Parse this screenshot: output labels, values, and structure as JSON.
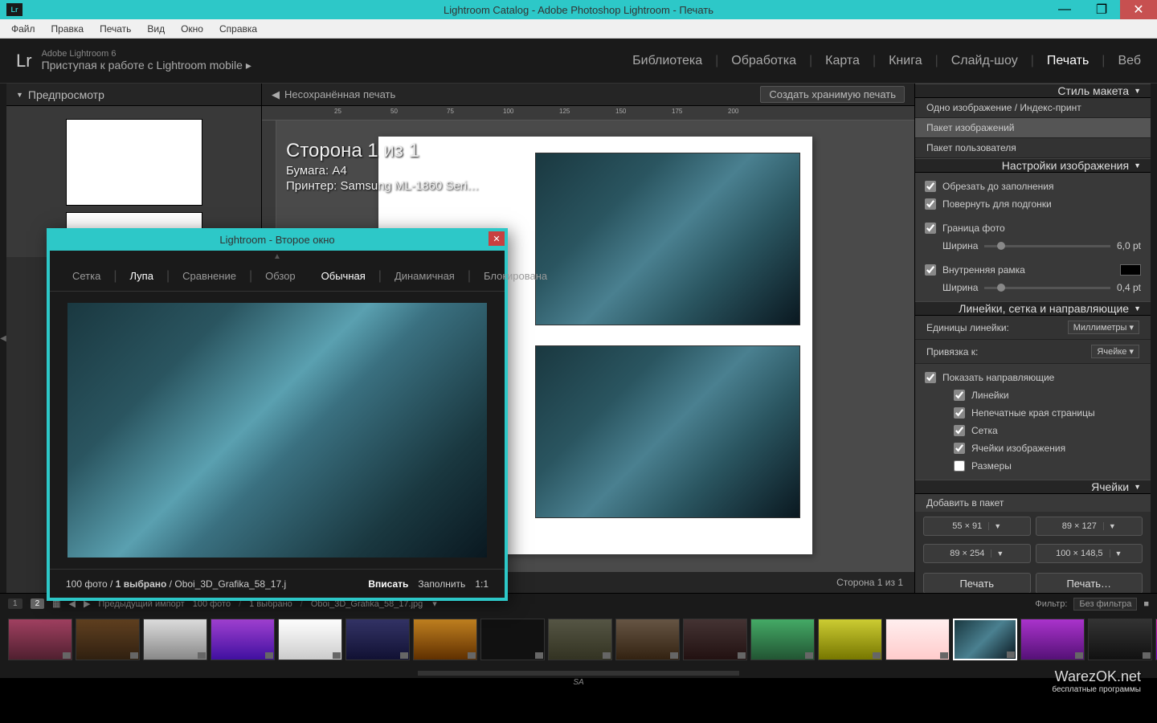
{
  "titlebar": {
    "icon": "Lr",
    "title": "Lightroom Catalog - Adobe Photoshop Lightroom - Печать"
  },
  "menubar": [
    "Файл",
    "Правка",
    "Печать",
    "Вид",
    "Окно",
    "Справка"
  ],
  "header": {
    "logo": "Lr",
    "subtitle_top": "Adobe Lightroom 6",
    "subtitle_bottom": "Приступая к работе с Lightroom mobile ▸",
    "nav": [
      "Библиотека",
      "Обработка",
      "Карта",
      "Книга",
      "Слайд-шоу",
      "Печать",
      "Веб"
    ],
    "nav_active": "Печать"
  },
  "left": {
    "preview_title": "Предпросмотр"
  },
  "center": {
    "unsaved": "Несохранённая печать",
    "create_stored": "Создать хранимую печать",
    "ruler_marks": [
      "25",
      "50",
      "75",
      "100",
      "125",
      "150",
      "175",
      "200"
    ],
    "page_title": "Сторона 1 из 1",
    "paper_label": "Бумага:",
    "paper_value": "A4",
    "printer_label": "Принтер:",
    "printer_value": "Samsung ML-1860 Seri…",
    "footer_page": "Сторона 1 из 1"
  },
  "right": {
    "layout_style": {
      "title": "Стиль макета",
      "options": [
        "Одно изображение / Индекс-принт",
        "Пакет изображений",
        "Пакет пользователя"
      ],
      "active": "Пакет изображений"
    },
    "image_settings": {
      "title": "Настройки изображения",
      "crop_fill": "Обрезать до заполнения",
      "rotate_fit": "Повернуть для подгонки",
      "photo_border": "Граница фото",
      "width_label": "Ширина",
      "border_value": "6,0",
      "border_unit": "pt",
      "inner_stroke": "Внутренняя рамка",
      "stroke_value": "0,4",
      "stroke_unit": "pt"
    },
    "rulers_grid": {
      "title": "Линейки, сетка и направляющие",
      "ruler_units_label": "Единицы линейки:",
      "ruler_units_value": "Миллиметры",
      "snap_label": "Привязка к:",
      "snap_value": "Ячейке",
      "show_guides": "Показать направляющие",
      "opt_rulers": "Линейки",
      "opt_bleed": "Непечатные края страницы",
      "opt_grid": "Сетка",
      "opt_cells": "Ячейки изображения",
      "opt_dims": "Размеры"
    },
    "cells": {
      "title": "Ячейки",
      "add_label": "Добавить в пакет",
      "presets": [
        "55 × 91",
        "89 × 127",
        "89 × 254",
        "100 × 148,5"
      ]
    },
    "footer": {
      "print_btn": "Печать",
      "print_dlg_btn": "Печать…"
    }
  },
  "filmstrip": {
    "badge1": "1",
    "badge2": "2",
    "prev_import": "Предыдущий импорт",
    "count": "100 фото",
    "selected": "1 выбрано",
    "filename": "Oboi_3D_Grafika_58_17.jpg",
    "filter_label": "Фильтр:",
    "filter_value": "Без фильтра"
  },
  "second_window": {
    "title": "Lightroom - Второе окно",
    "tabs": [
      "Сетка",
      "Лупа",
      "Сравнение",
      "Обзор",
      "Обычная",
      "Динамичная",
      "Блокирована"
    ],
    "active_tabs": [
      "Лупа",
      "Обычная"
    ],
    "footer_count": "100 фото",
    "footer_selected": "1 выбрано",
    "footer_file": "Oboi_3D_Grafika_58_17.j",
    "fit": "Вписать",
    "fill": "Заполнить",
    "ratio": "1:1"
  },
  "watermark": {
    "main": "WarezOK.net",
    "sub": "бесплатные программы"
  },
  "sa": "SA"
}
